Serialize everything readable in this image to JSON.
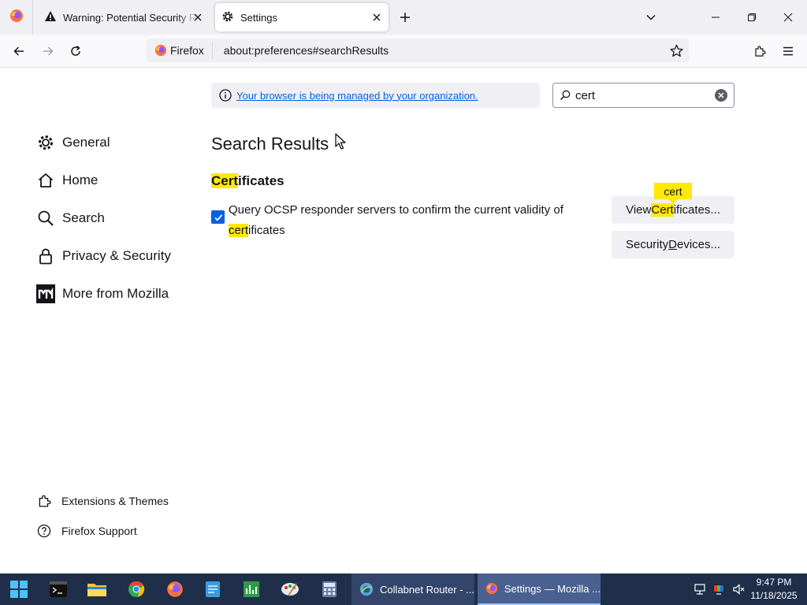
{
  "tabs": [
    {
      "title": "Warning: Potential Security Risk",
      "icon": "warning-icon",
      "active": false
    },
    {
      "title": "Settings",
      "icon": "gear-icon",
      "active": true
    }
  ],
  "navbar": {
    "identity_label": "Firefox",
    "url": "about:preferences#searchResults"
  },
  "sidebar": {
    "categories": [
      {
        "label": "General",
        "icon": "gear-icon"
      },
      {
        "label": "Home",
        "icon": "home-icon"
      },
      {
        "label": "Search",
        "icon": "search-icon"
      },
      {
        "label": "Privacy & Security",
        "icon": "lock-icon"
      },
      {
        "label": "More from Mozilla",
        "icon": "mozilla-m-icon"
      }
    ],
    "footer": [
      {
        "label": "Extensions & Themes",
        "icon": "puzzle-icon"
      },
      {
        "label": "Firefox Support",
        "icon": "help-icon"
      }
    ]
  },
  "policy_notice": {
    "link": "Your browser is being managed by your organization."
  },
  "search": {
    "query": "cert"
  },
  "results": {
    "heading": "Search Results",
    "section": {
      "highlight": "Cert",
      "rest": "ificates"
    },
    "ocsp": {
      "before": "Query OCSP responder servers to confirm the current validity of ",
      "highlight": "cert",
      "after": "ificates",
      "checked": true
    },
    "view_button": {
      "before": "View ",
      "highlight": "Cert",
      "after": "ificates..."
    },
    "security_button": {
      "before": "Security ",
      "underline": "D",
      "after": "evices..."
    },
    "tooltip": "cert"
  },
  "taskbar": {
    "tasks": [
      {
        "label": "Collabnet Router - ...",
        "icon": "collabnet-icon"
      },
      {
        "label": "Settings — Mozilla ...",
        "icon": "firefox-icon",
        "active": true
      }
    ],
    "clock": {
      "time": "9:47 PM",
      "date": "11/18/2025"
    }
  },
  "colors": {
    "accent": "#0061e0",
    "highlight": "#ffe900",
    "taskbar": "#1f2f4a"
  }
}
